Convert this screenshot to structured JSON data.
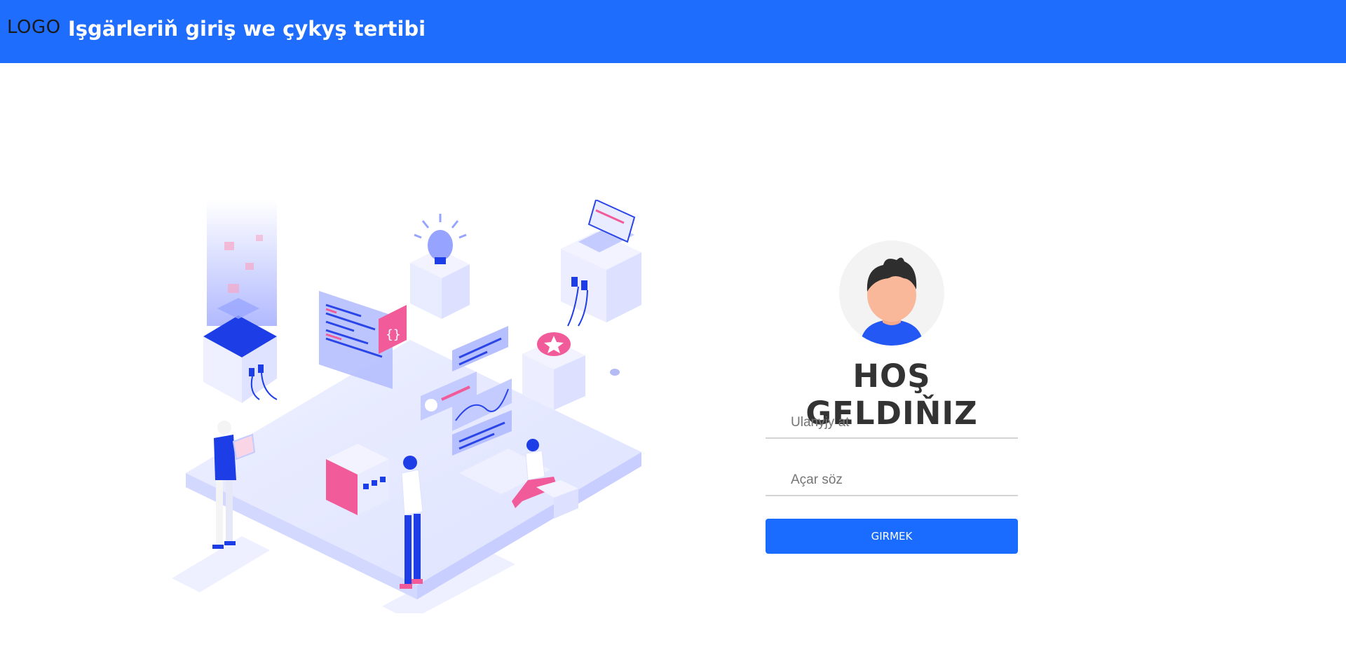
{
  "header": {
    "logo": "LOGO",
    "title": "Işgärleriň giriş we çykyş tertibi",
    "background_color": "#1f6dfd"
  },
  "illustration": {
    "icon": "isometric-office-illustration"
  },
  "login": {
    "avatar_icon": "user-avatar-icon",
    "heading": "HOŞ GELDIŇIZ",
    "username_placeholder": "Ulanyjy at",
    "username_value": "",
    "password_placeholder": "Açar söz",
    "password_value": "",
    "submit_label": "GIRMEK",
    "accent_color": "#1a6bff"
  }
}
